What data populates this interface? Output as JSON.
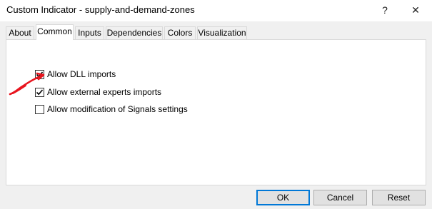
{
  "window": {
    "title": "Custom Indicator - supply-and-demand-zones",
    "help_glyph": "?",
    "close_glyph": "✕"
  },
  "tabs": [
    {
      "label": "About",
      "active": false
    },
    {
      "label": "Common",
      "active": true
    },
    {
      "label": "Inputs",
      "active": false
    },
    {
      "label": "Dependencies",
      "active": false
    },
    {
      "label": "Colors",
      "active": false
    },
    {
      "label": "Visualization",
      "active": false
    }
  ],
  "options": [
    {
      "label": "Allow DLL imports",
      "checked": true
    },
    {
      "label": "Allow external experts imports",
      "checked": true
    },
    {
      "label": "Allow modification of Signals settings",
      "checked": false
    }
  ],
  "buttons": {
    "ok": "OK",
    "cancel": "Cancel",
    "reset": "Reset"
  },
  "colors": {
    "annotation": "#e8141e",
    "default_button_border": "#0078d7"
  },
  "annotation": {
    "shape": "hand-drawn red arrow",
    "points_to": "Allow DLL imports"
  }
}
